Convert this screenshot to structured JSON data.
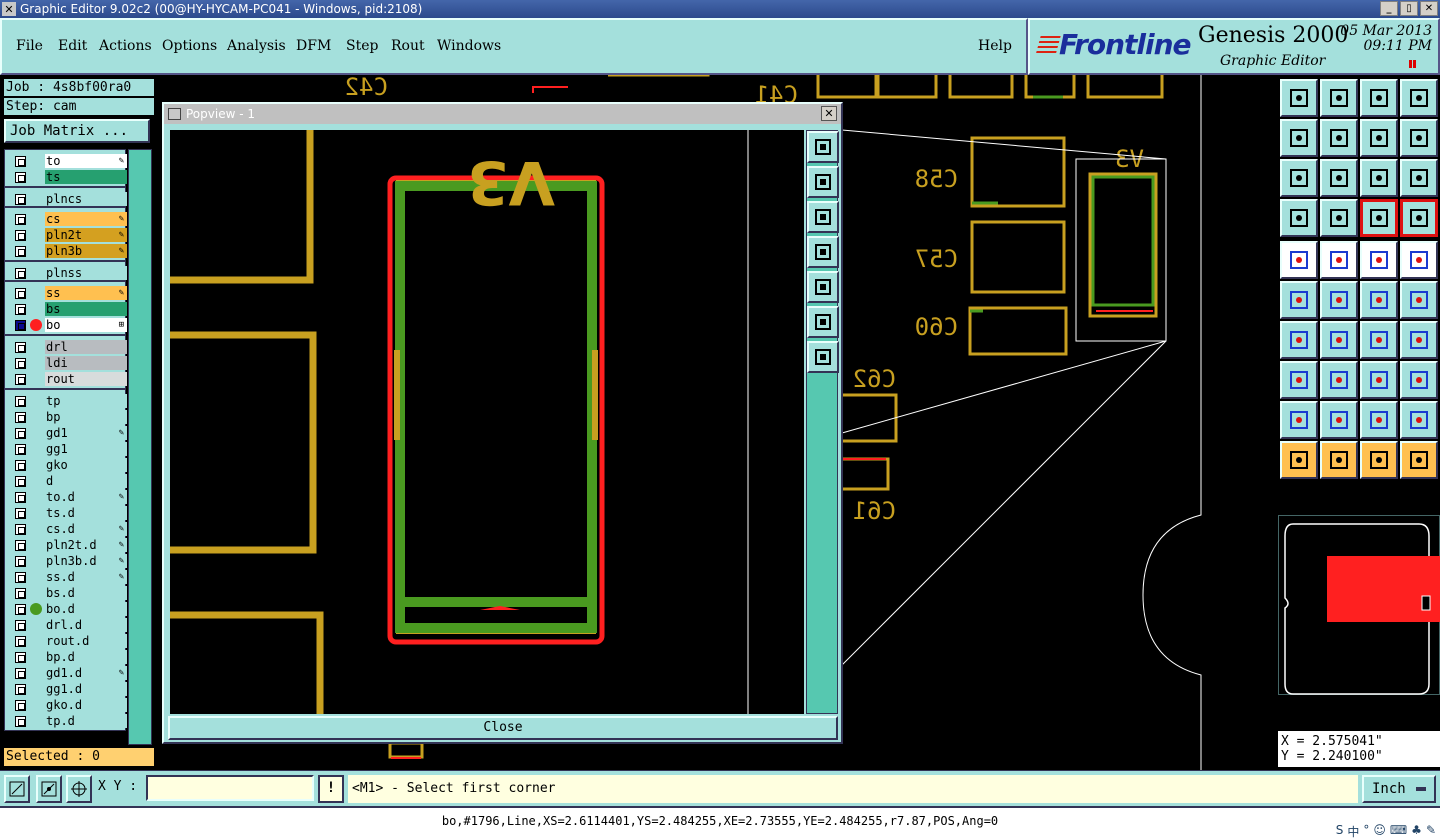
{
  "window": {
    "title": "Graphic Editor 9.02c2 (00@HY-HYCAM-PC041 - Windows, pid:2108)",
    "min": "_",
    "max": "▯",
    "close": "✕"
  },
  "menu": [
    "File",
    "Edit",
    "Actions",
    "Options",
    "Analysis",
    "DFM",
    "Step",
    "Rout",
    "Windows"
  ],
  "help": "Help",
  "brand": {
    "logo": "Frontline",
    "product": "Genesis 2000",
    "subtitle": "Graphic Editor",
    "date": "05 Mar 2013",
    "time": "09:11 PM"
  },
  "job": {
    "job_label": "Job : 4s8bf00ra0",
    "step_label": "Step: cam",
    "matrix_button": "Job Matrix ..."
  },
  "layers": [
    {
      "name": "to",
      "bg": "#ffffff",
      "mark": "✎"
    },
    {
      "name": "ts",
      "bg": "#26a070",
      "mark": ""
    },
    {
      "name": "plncs",
      "bg": "#a4e0dc",
      "mark": ""
    },
    {
      "name": "cs",
      "bg": "#ffc050",
      "mark": "✎"
    },
    {
      "name": "pln2t",
      "bg": "#d4a020",
      "mark": "✎"
    },
    {
      "name": "pln3b",
      "bg": "#d4a020",
      "mark": "✎"
    },
    {
      "name": "plnss",
      "bg": "#a4e0dc",
      "mark": ""
    },
    {
      "name": "ss",
      "bg": "#ffc050",
      "mark": "✎"
    },
    {
      "name": "bs",
      "bg": "#26a070",
      "mark": ""
    },
    {
      "name": "bo",
      "bg": "#ffffff",
      "mark": "⊞"
    },
    {
      "name": "drl",
      "bg": "#b8bcc0",
      "mark": ""
    },
    {
      "name": "ldi",
      "bg": "#b8bcc0",
      "mark": ""
    },
    {
      "name": "rout",
      "bg": "#d8dcdc",
      "mark": ""
    },
    {
      "name": "tp",
      "bg": "#a4e0dc",
      "mark": ""
    },
    {
      "name": "bp",
      "bg": "#a4e0dc",
      "mark": ""
    },
    {
      "name": "gd1",
      "bg": "#a4e0dc",
      "mark": "✎"
    },
    {
      "name": "gg1",
      "bg": "#a4e0dc",
      "mark": ""
    },
    {
      "name": "gko",
      "bg": "#a4e0dc",
      "mark": ""
    },
    {
      "name": "d",
      "bg": "#a4e0dc",
      "mark": ""
    },
    {
      "name": "to.d",
      "bg": "#a4e0dc",
      "mark": "✎"
    },
    {
      "name": "ts.d",
      "bg": "#a4e0dc",
      "mark": ""
    },
    {
      "name": "cs.d",
      "bg": "#a4e0dc",
      "mark": "✎"
    },
    {
      "name": "pln2t.d",
      "bg": "#a4e0dc",
      "mark": "✎"
    },
    {
      "name": "pln3b.d",
      "bg": "#a4e0dc",
      "mark": "✎"
    },
    {
      "name": "ss.d",
      "bg": "#a4e0dc",
      "mark": "✎"
    },
    {
      "name": "bs.d",
      "bg": "#a4e0dc",
      "mark": ""
    },
    {
      "name": "bo.d",
      "bg": "#a4e0dc",
      "mark": ""
    },
    {
      "name": "drl.d",
      "bg": "#a4e0dc",
      "mark": ""
    },
    {
      "name": "rout.d",
      "bg": "#a4e0dc",
      "mark": ""
    },
    {
      "name": "bp.d",
      "bg": "#a4e0dc",
      "mark": ""
    },
    {
      "name": "gd1.d",
      "bg": "#a4e0dc",
      "mark": "✎"
    },
    {
      "name": "gg1.d",
      "bg": "#a4e0dc",
      "mark": ""
    },
    {
      "name": "gko.d",
      "bg": "#a4e0dc",
      "mark": ""
    },
    {
      "name": "tp.d",
      "bg": "#a4e0dc",
      "mark": ""
    }
  ],
  "selected": "Selected : 0",
  "popview": {
    "title": "Popview - 1",
    "close_label": "Close",
    "silk_text": "V3"
  },
  "canvas_labels": [
    "C42",
    "C58",
    "C57",
    "C60",
    "C62",
    "C61",
    "V3",
    "C41"
  ],
  "coords": {
    "x": "X = 2.575041\"",
    "y": "Y = 2.240100\""
  },
  "bottom": {
    "xy_label": "X Y :",
    "xy_value": "",
    "excl": "!",
    "prompt": "<M1> - Select first corner",
    "units": "Inch"
  },
  "status": "bo,#1796,Line,XS=2.6114401,YS=2.484255,XE=2.73555,YE=2.484255,r7.87,POS,Ang=0",
  "tray": [
    "S",
    "中",
    "°",
    "☺",
    "⌨",
    "♣",
    "✎"
  ],
  "colors": {
    "panel": "#a4e0dc",
    "silk": "#c8a020",
    "pad": "#ff2020",
    "copper": "#4a9a20"
  }
}
